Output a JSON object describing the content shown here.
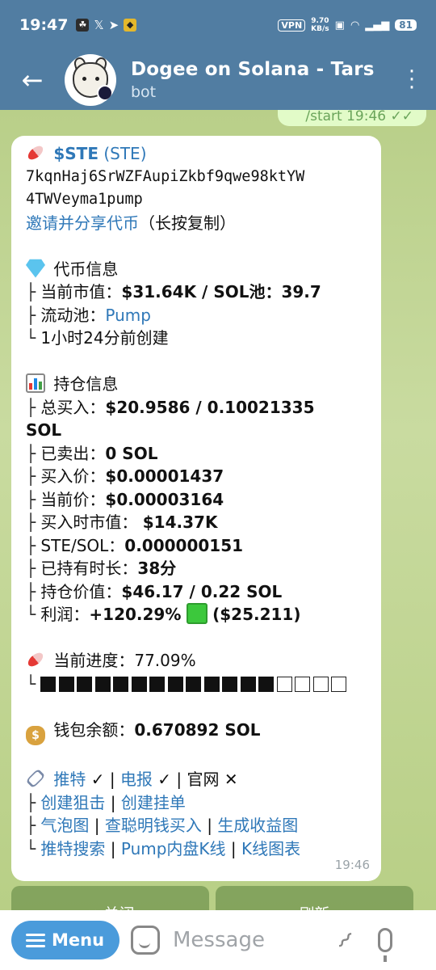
{
  "status_bar": {
    "time": "19:47",
    "vpn": "VPN",
    "speed_top": "9.70",
    "speed_bottom": "KB/s",
    "battery": "81"
  },
  "header": {
    "back_icon": "arrow-left-icon",
    "title": "Dogee on Solana - Tars",
    "subtitle": "bot"
  },
  "sent_message": {
    "text": "/start",
    "time": "19:46"
  },
  "message": {
    "token_line": {
      "symbol": "$STE",
      "name": "(STE)"
    },
    "address_line1": "7kqnHaj6SrWZFAupiZkbf9qwe98ktYW",
    "address_line2": "4TWVeyma1pump",
    "invite_link": "邀请并分享代币",
    "invite_note": "（长按复制）",
    "token_info": {
      "title": "代币信息",
      "market_cap_label": "当前市值：",
      "market_cap_value": "$31.64K / SOL池：39.7",
      "pool_label": "流动池：",
      "pool_value": "Pump",
      "created": "1小时24分前创建"
    },
    "holding": {
      "title": "持仓信息",
      "total_buy_label": "总买入：",
      "total_buy_value": "$20.9586 / 0.10021335",
      "total_buy_cont": "SOL",
      "sold_label": "已卖出：",
      "sold_value": "0 SOL",
      "buy_price_label": "买入价：",
      "buy_price_value": "$0.00001437",
      "cur_price_label": "当前价：",
      "cur_price_value": "$0.00003164",
      "buy_mc_label": "买入时市值：",
      "buy_mc_value": "$14.37K",
      "ste_sol_label": "STE/SOL：",
      "ste_sol_value": "0.000000151",
      "hold_time_label": "已持有时长：",
      "hold_time_value": "38分",
      "hold_value_label": "持仓价值：",
      "hold_value_value": "$46.17 / 0.22 SOL",
      "profit_label": "利润：",
      "profit_value": "+120.29%",
      "profit_usd": "($25.211)"
    },
    "progress": {
      "label": "当前进度：",
      "value": "77.09%",
      "filled": 13,
      "total": 17
    },
    "wallet": {
      "label": "钱包余额：",
      "value": "0.670892 SOL"
    },
    "links": {
      "twitter": "推特",
      "telegram": "电报",
      "website": "官网",
      "check": "✓",
      "cross": "✕",
      "snipe": "创建狙击",
      "order": "创建挂单",
      "bubble": "气泡图",
      "smart_money": "查聪明钱买入",
      "profit_chart": "生成收益图",
      "twitter_search": "推特搜索",
      "pump_kline": "Pump内盘K线",
      "kline": "K线图表"
    },
    "time": "19:46"
  },
  "keyboard": {
    "close": "× 关闭",
    "refresh": "刷新"
  },
  "input_bar": {
    "menu": "Menu",
    "placeholder": "Message"
  }
}
